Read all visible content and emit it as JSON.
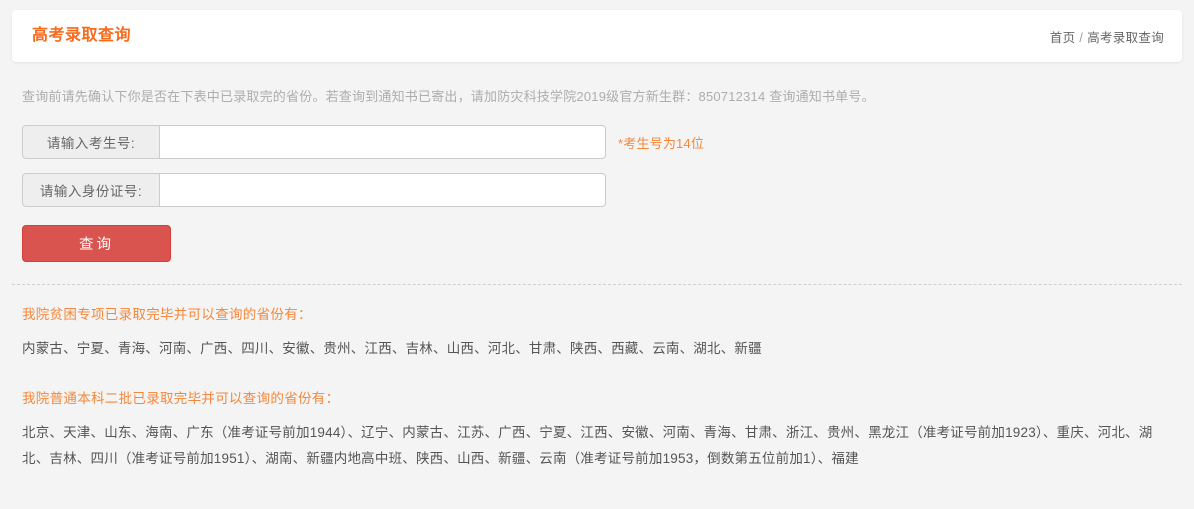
{
  "header": {
    "title": "高考录取查询",
    "breadcrumb": {
      "home": "首页",
      "separator": "/",
      "current": "高考录取查询"
    }
  },
  "intro": {
    "text": "查询前请先确认下你是否在下表中已录取完的省份。若查询到通知书已寄出，请加防灾科技学院2019级官方新生群：850712314 查询通知书单号。"
  },
  "form": {
    "fields": [
      {
        "label": "请输入考生号:",
        "value": "",
        "placeholder": "",
        "hint": "*考生号为14位"
      },
      {
        "label": "请输入身份证号:",
        "value": "",
        "placeholder": "",
        "hint": ""
      }
    ],
    "submit_label": "查询"
  },
  "notices": [
    {
      "heading": "我院贫困专项已录取完毕并可以查询的省份有：",
      "body": "内蒙古、宁夏、青海、河南、广西、四川、安徽、贵州、江西、吉林、山西、河北、甘肃、陕西、西藏、云南、湖北、新疆"
    },
    {
      "heading": "我院普通本科二批已录取完毕并可以查询的省份有：",
      "body": "北京、天津、山东、海南、广东（准考证号前加1944）、辽宁、内蒙古、江苏、广西、宁夏、江西、安徽、河南、青海、甘肃、浙江、贵州、黑龙江（准考证号前加1923）、重庆、河北、湖北、吉林、四川（准考证号前加1951）、湖南、新疆内地高中班、陕西、山西、新疆、云南（准考证号前加1953，倒数第五位前加1）、福建"
    }
  ],
  "colors": {
    "accent_orange": "#f96a1b",
    "hint_orange": "#f6873a",
    "submit_red": "#d9534f",
    "page_background": "#f4f4f4",
    "card_background": "#ffffff",
    "body_text": "#555555",
    "muted_text": "#adadad"
  }
}
